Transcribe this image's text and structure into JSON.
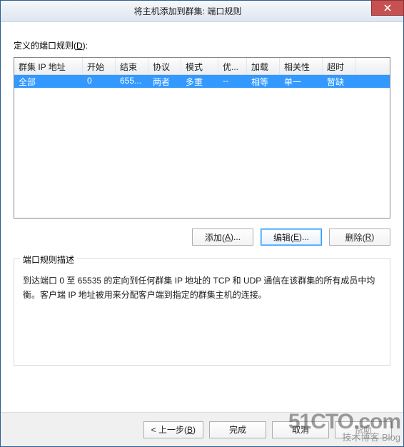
{
  "window": {
    "title": "将主机添加到群集: 端口规则"
  },
  "section": {
    "label_pre": "定义的端口规则(",
    "label_key": "D",
    "label_post": "):"
  },
  "columns": {
    "c0": "群集 IP 地址",
    "c1": "开始",
    "c2": "结束",
    "c3": "协议",
    "c4": "模式",
    "c5": "优...",
    "c6": "加载",
    "c7": "相关性",
    "c8": "超时"
  },
  "row": {
    "c0": "全部",
    "c1": "0",
    "c2": "655...",
    "c3": "两者",
    "c4": "多重",
    "c5": "--",
    "c6": "相等",
    "c7": "单一",
    "c8": "暂缺"
  },
  "buttons": {
    "add_pre": "添加(",
    "add_key": "A",
    "add_post": ")...",
    "edit_pre": "编辑(",
    "edit_key": "E",
    "edit_post": ")...",
    "remove_pre": "删除(",
    "remove_key": "R",
    "remove_post": ")"
  },
  "group": {
    "legend": "端口规则描述",
    "desc": "到达端口 0 至 65535 的定向到任何群集 IP 地址的 TCP 和 UDP 通信在该群集的所有成员中均衡。客户端 IP 地址被用来分配客户端到指定的群集主机的连接。"
  },
  "footer": {
    "back_pre": "< 上一步(",
    "back_key": "B",
    "back_post": ")",
    "next": "完成",
    "cancel": "取消",
    "help": "帮助"
  },
  "watermark": {
    "big": "51CTO.com",
    "small": "技术博客 Blog"
  }
}
